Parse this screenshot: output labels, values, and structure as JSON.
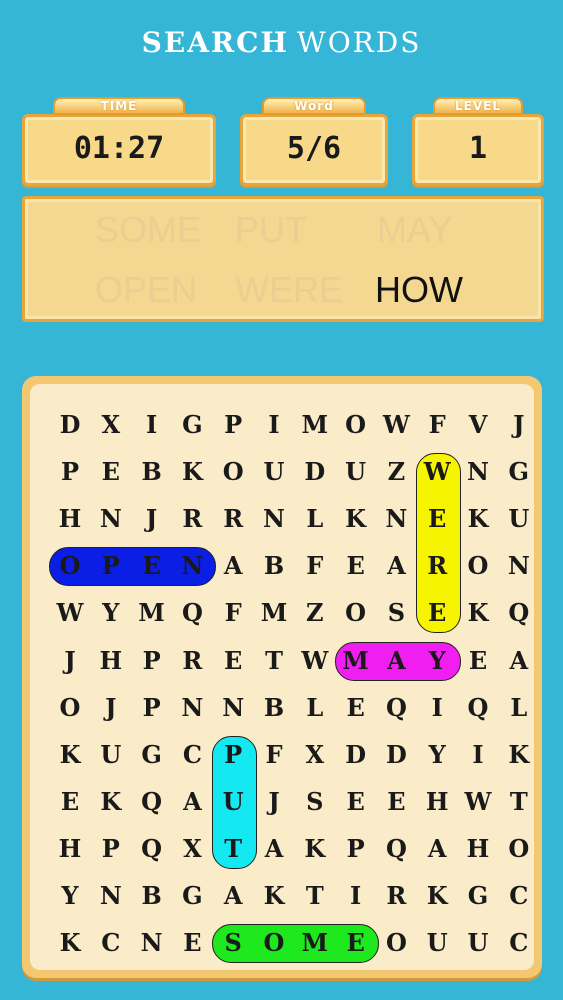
{
  "header": {
    "title_bold": "SEARCH",
    "title_light": "WORDS"
  },
  "stats": {
    "time": {
      "label": "TIME",
      "value": "01:27"
    },
    "word": {
      "label": "Word",
      "value": "5/6"
    },
    "level": {
      "label": "LEVEL",
      "value": "1"
    }
  },
  "word_list": [
    {
      "text": "SOME",
      "found": true
    },
    {
      "text": "PUT",
      "found": true
    },
    {
      "text": "MAY",
      "found": true
    },
    {
      "text": "OPEN",
      "found": true
    },
    {
      "text": "WERE",
      "found": true
    },
    {
      "text": "HOW",
      "found": false
    }
  ],
  "grid": [
    [
      "D",
      "X",
      "I",
      "G",
      "P",
      "I",
      "M",
      "O",
      "W",
      "F",
      "V",
      "J"
    ],
    [
      "P",
      "E",
      "B",
      "K",
      "O",
      "U",
      "D",
      "U",
      "Z",
      "W",
      "N",
      "G"
    ],
    [
      "H",
      "N",
      "J",
      "R",
      "R",
      "N",
      "L",
      "K",
      "N",
      "E",
      "K",
      "U"
    ],
    [
      "O",
      "P",
      "E",
      "N",
      "A",
      "B",
      "F",
      "E",
      "A",
      "R",
      "O",
      "N"
    ],
    [
      "W",
      "Y",
      "M",
      "Q",
      "F",
      "M",
      "Z",
      "O",
      "S",
      "E",
      "K",
      "Q"
    ],
    [
      "J",
      "H",
      "P",
      "R",
      "E",
      "T",
      "W",
      "M",
      "A",
      "Y",
      "E",
      "A"
    ],
    [
      "O",
      "J",
      "P",
      "N",
      "N",
      "B",
      "L",
      "E",
      "Q",
      "I",
      "Q",
      "L"
    ],
    [
      "K",
      "U",
      "G",
      "C",
      "P",
      "F",
      "X",
      "D",
      "D",
      "Y",
      "I",
      "K"
    ],
    [
      "E",
      "K",
      "Q",
      "A",
      "U",
      "J",
      "S",
      "E",
      "E",
      "H",
      "W",
      "T"
    ],
    [
      "H",
      "P",
      "Q",
      "X",
      "T",
      "A",
      "K",
      "P",
      "Q",
      "A",
      "H",
      "O"
    ],
    [
      "Y",
      "N",
      "B",
      "G",
      "A",
      "K",
      "T",
      "I",
      "R",
      "K",
      "G",
      "C"
    ],
    [
      "K",
      "C",
      "N",
      "E",
      "S",
      "O",
      "M",
      "E",
      "O",
      "U",
      "U",
      "C"
    ]
  ],
  "highlights": [
    {
      "word": "OPEN",
      "color": "#0a1ee6",
      "r0": 3,
      "c0": 0,
      "r1": 3,
      "c1": 3
    },
    {
      "word": "WERE",
      "color": "#f7f400",
      "r0": 1,
      "c0": 9,
      "r1": 4,
      "c1": 9
    },
    {
      "word": "MAY",
      "color": "#f01ef0",
      "r0": 5,
      "c0": 7,
      "r1": 5,
      "c1": 9
    },
    {
      "word": "PUT",
      "color": "#14e8f0",
      "r0": 7,
      "c0": 4,
      "r1": 9,
      "c1": 4
    },
    {
      "word": "SOME",
      "color": "#1ee81e",
      "r0": 11,
      "c0": 4,
      "r1": 11,
      "c1": 7
    }
  ]
}
